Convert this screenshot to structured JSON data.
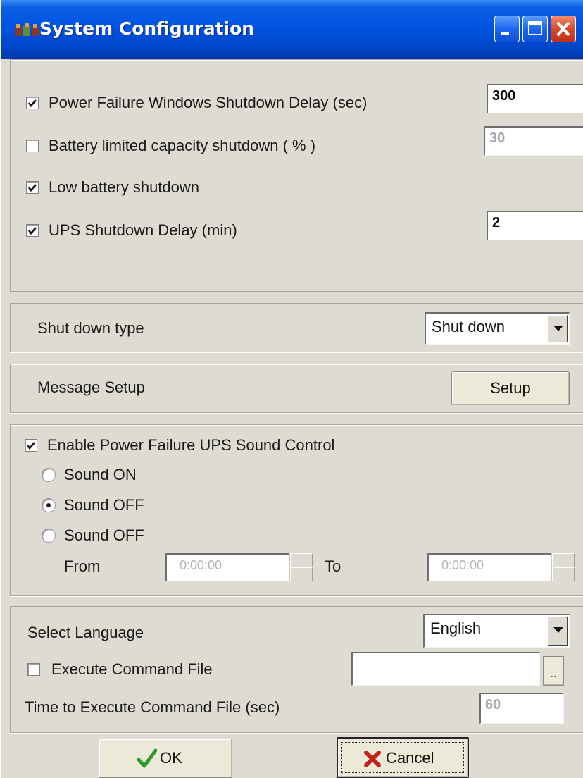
{
  "window": {
    "title": "System Configuration",
    "controls": [
      "minimize-icon",
      "maximize-icon",
      "close-icon"
    ]
  },
  "shutdown_settings": {
    "power_failure_delay": {
      "label": "Power Failure Windows Shutdown Delay (sec)",
      "checked": true,
      "value": "300"
    },
    "battery_capacity": {
      "label": "Battery limited  capacity shutdown ( % )",
      "checked": false,
      "value": "30",
      "disabled": true
    },
    "low_battery": {
      "label": "Low battery shutdown",
      "checked": true
    },
    "ups_delay": {
      "label": "UPS Shutdown Delay (min)",
      "checked": true,
      "value": "2"
    }
  },
  "shutdown_type": {
    "label": "Shut down type",
    "selected": "Shut down"
  },
  "message_setup": {
    "label": "Message Setup",
    "button": "Setup"
  },
  "sound": {
    "enable_label": "Enable Power Failure UPS Sound Control",
    "enable_checked": true,
    "options": [
      {
        "label": "Sound ON",
        "selected": false
      },
      {
        "label": "Sound OFF",
        "selected": true
      },
      {
        "label": "Sound OFF",
        "selected": false
      }
    ],
    "from_label": "From",
    "from_value": "0:00:00",
    "to_label": "To",
    "to_value": "0:00:00"
  },
  "language": {
    "label": "Select Language",
    "selected": "English"
  },
  "command_file": {
    "label": "Execute Command File",
    "checked": false,
    "value": "",
    "browse": "..",
    "time_label": "Time to Execute Command File (sec)",
    "time_value": "60"
  },
  "buttons": {
    "ok": "OK",
    "cancel": "Cancel"
  }
}
